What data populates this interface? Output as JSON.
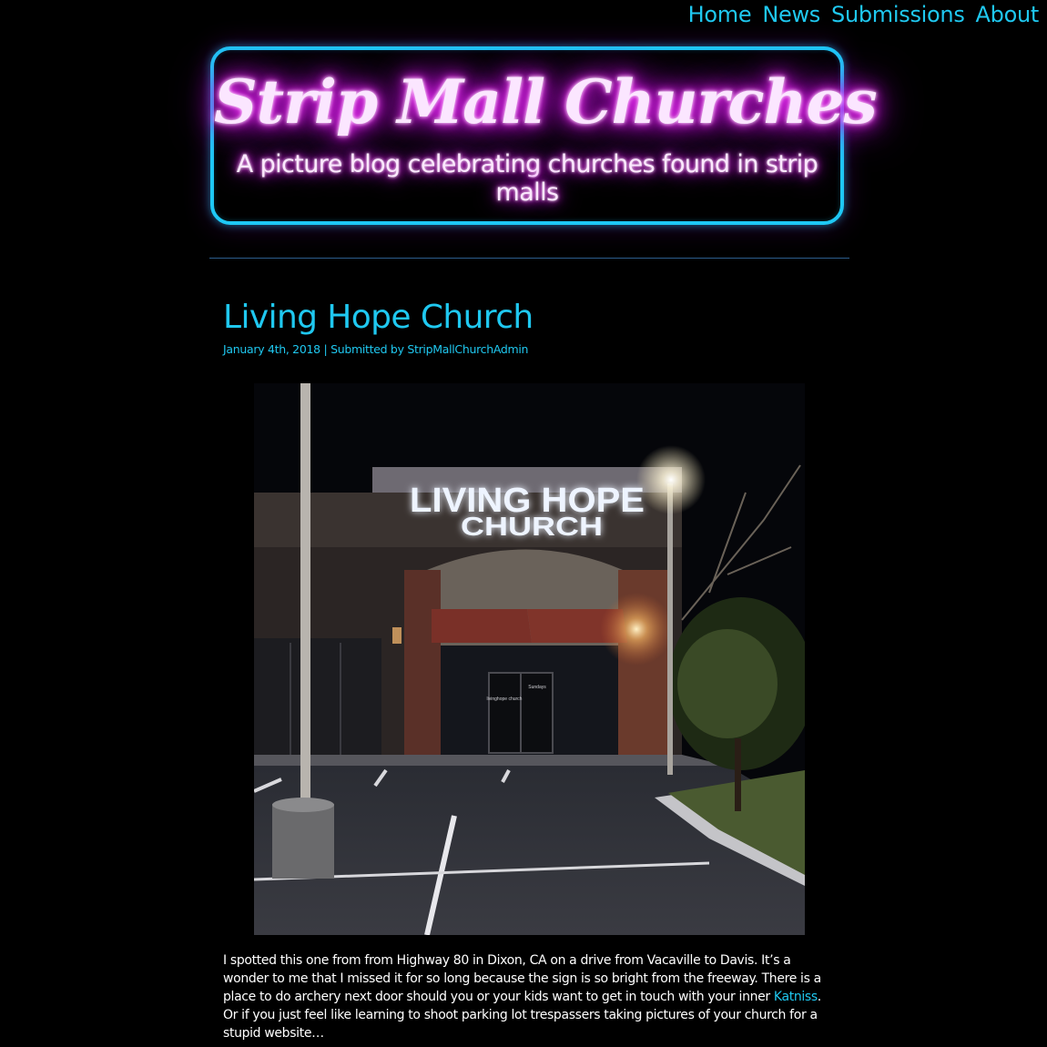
{
  "nav": {
    "items": [
      "Home",
      "News",
      "Submissions",
      "About"
    ]
  },
  "site": {
    "title": "Strip Mall Churches",
    "tagline": "A picture blog celebrating churches found in strip malls"
  },
  "post": {
    "title": "Living Hope Church",
    "date": "January 4th, 2018",
    "separator": "|",
    "submitted_by": "Submitted by StripMallChurchAdmin",
    "photo": {
      "sign_line1": "LIVING HOPE",
      "sign_line2": "CHURCH",
      "door_text_left": "livinghope church",
      "door_text_right": "Sundays"
    },
    "body": {
      "before_link": "I spotted this one from from Highway 80 in Dixon, CA on a drive from Vacaville to Davis. It’s a wonder to me that I missed it for so long because the sign is so bright from the freeway. There is a place to do archery next door should you or your kids want to get in touch with your inner ",
      "link": "Katniss",
      "after_link": ". Or if you just feel like learning to shoot parking lot trespassers taking pictures of your church for a stupid website…"
    }
  },
  "colors": {
    "accent": "#1fc8f0",
    "neon_pink": "#e020f0",
    "background": "#000000"
  }
}
